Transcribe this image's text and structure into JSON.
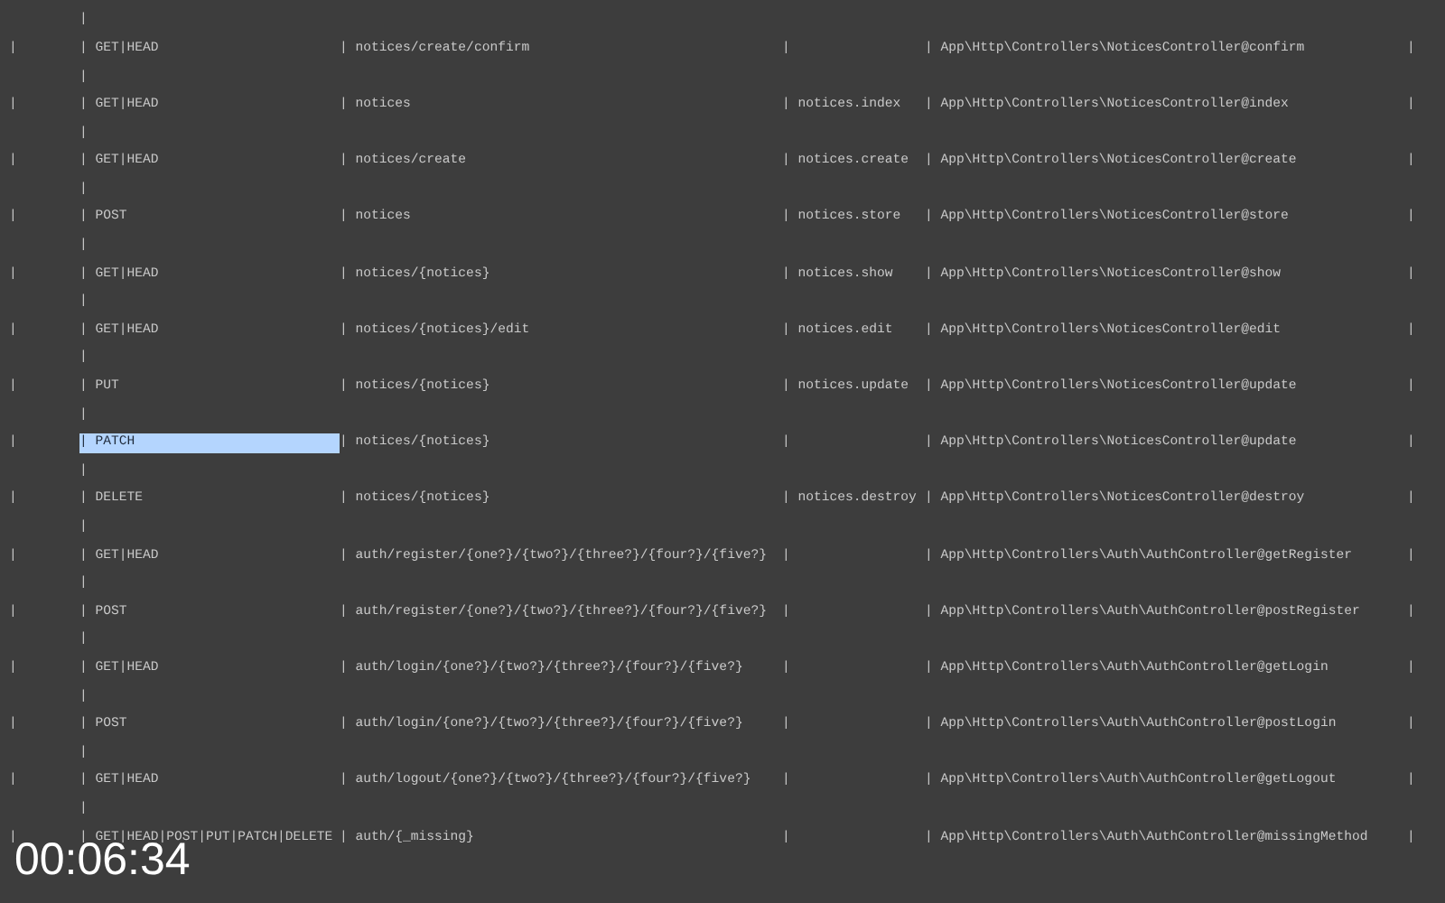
{
  "terminal": {
    "lines": [
      {
        "kind": "continuation",
        "text": "|"
      },
      {
        "kind": "route",
        "selected": false,
        "cells": [
          "|",
          "| GET|HEAD",
          "| notices/create/confirm",
          "|",
          "| App\\Http\\Controllers\\NoticesController@confirm",
          "|"
        ]
      },
      {
        "kind": "continuation",
        "text": "|"
      },
      {
        "kind": "route",
        "selected": false,
        "cells": [
          "|",
          "| GET|HEAD",
          "| notices",
          "| notices.index",
          "| App\\Http\\Controllers\\NoticesController@index",
          "|"
        ]
      },
      {
        "kind": "continuation",
        "text": "|"
      },
      {
        "kind": "route",
        "selected": false,
        "cells": [
          "|",
          "| GET|HEAD",
          "| notices/create",
          "| notices.create",
          "| App\\Http\\Controllers\\NoticesController@create",
          "|"
        ]
      },
      {
        "kind": "continuation",
        "text": "|"
      },
      {
        "kind": "route",
        "selected": false,
        "cells": [
          "|",
          "| POST",
          "| notices",
          "| notices.store",
          "| App\\Http\\Controllers\\NoticesController@store",
          "|"
        ]
      },
      {
        "kind": "continuation",
        "text": "|"
      },
      {
        "kind": "route",
        "selected": false,
        "cells": [
          "|",
          "| GET|HEAD",
          "| notices/{notices}",
          "| notices.show",
          "| App\\Http\\Controllers\\NoticesController@show",
          "|"
        ]
      },
      {
        "kind": "continuation",
        "text": "|"
      },
      {
        "kind": "route",
        "selected": false,
        "cells": [
          "|",
          "| GET|HEAD",
          "| notices/{notices}/edit",
          "| notices.edit",
          "| App\\Http\\Controllers\\NoticesController@edit",
          "|"
        ]
      },
      {
        "kind": "continuation",
        "text": "|"
      },
      {
        "kind": "route",
        "selected": false,
        "cells": [
          "|",
          "| PUT",
          "| notices/{notices}",
          "| notices.update",
          "| App\\Http\\Controllers\\NoticesController@update",
          "|"
        ]
      },
      {
        "kind": "continuation",
        "text": "|"
      },
      {
        "kind": "route",
        "selected": true,
        "cells": [
          "|",
          "| PATCH",
          "| notices/{notices}",
          "|",
          "| App\\Http\\Controllers\\NoticesController@update",
          "|"
        ]
      },
      {
        "kind": "continuation",
        "text": "|"
      },
      {
        "kind": "route",
        "selected": false,
        "cells": [
          "|",
          "| DELETE",
          "| notices/{notices}",
          "| notices.destroy",
          "| App\\Http\\Controllers\\NoticesController@destroy",
          "|"
        ]
      },
      {
        "kind": "continuation",
        "text": "|"
      },
      {
        "kind": "route",
        "selected": false,
        "cells": [
          "|",
          "| GET|HEAD",
          "| auth/register/{one?}/{two?}/{three?}/{four?}/{five?}",
          "|",
          "| App\\Http\\Controllers\\Auth\\AuthController@getRegister",
          "|"
        ]
      },
      {
        "kind": "continuation",
        "text": "|"
      },
      {
        "kind": "route",
        "selected": false,
        "cells": [
          "|",
          "| POST",
          "| auth/register/{one?}/{two?}/{three?}/{four?}/{five?}",
          "|",
          "| App\\Http\\Controllers\\Auth\\AuthController@postRegister",
          "|"
        ]
      },
      {
        "kind": "continuation",
        "text": "|"
      },
      {
        "kind": "route",
        "selected": false,
        "cells": [
          "|",
          "| GET|HEAD",
          "| auth/login/{one?}/{two?}/{three?}/{four?}/{five?}",
          "|",
          "| App\\Http\\Controllers\\Auth\\AuthController@getLogin",
          "|"
        ]
      },
      {
        "kind": "continuation",
        "text": "|"
      },
      {
        "kind": "route",
        "selected": false,
        "cells": [
          "|",
          "| POST",
          "| auth/login/{one?}/{two?}/{three?}/{four?}/{five?}",
          "|",
          "| App\\Http\\Controllers\\Auth\\AuthController@postLogin",
          "|"
        ]
      },
      {
        "kind": "continuation",
        "text": "|"
      },
      {
        "kind": "route",
        "selected": false,
        "cells": [
          "|",
          "| GET|HEAD",
          "| auth/logout/{one?}/{two?}/{three?}/{four?}/{five?}",
          "|",
          "| App\\Http\\Controllers\\Auth\\AuthController@getLogout",
          "|"
        ]
      },
      {
        "kind": "continuation",
        "text": "|"
      },
      {
        "kind": "route",
        "selected": false,
        "cells": [
          "|",
          "| GET|HEAD|POST|PUT|PATCH|DELETE",
          "| auth/{_missing}",
          "|",
          "| App\\Http\\Controllers\\Auth\\AuthController@missingMethod",
          "|"
        ]
      }
    ]
  },
  "timecode": "00:06:34"
}
